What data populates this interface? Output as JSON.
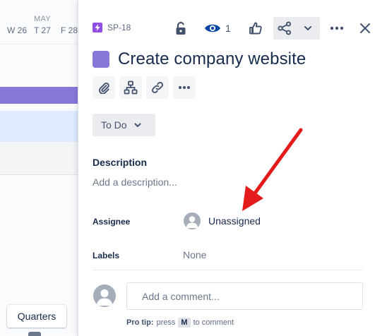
{
  "timeline": {
    "month": "MAY",
    "weeks": [
      "W 26",
      "T 27",
      "F 28"
    ],
    "quarters_label": "Quarters"
  },
  "issue": {
    "key": "SP-18",
    "watch_count": "1",
    "title": "Create company website",
    "status": "To Do",
    "description_label": "Description",
    "description_placeholder": "Add a description...",
    "fields": {
      "assignee_label": "Assignee",
      "assignee_value": "Unassigned",
      "labels_label": "Labels",
      "labels_value": "None"
    },
    "comment_placeholder": "Add a comment...",
    "protip": {
      "label": "Pro tip:",
      "press": "press",
      "key": "M",
      "suffix": "to comment"
    }
  },
  "icons": [
    "lightning-story-icon",
    "lock-icon",
    "eye-icon",
    "thumbs-up-icon",
    "share-icon",
    "chevron-down-icon",
    "more-horizontal-icon",
    "close-icon",
    "paperclip-icon",
    "hierarchy-icon",
    "link-icon",
    "avatar-icon"
  ],
  "colors": {
    "accent_purple": "#8777d9",
    "story_purple": "#904ee2",
    "annotation_red": "#e31b1b",
    "watch_blue": "#0747a6"
  }
}
